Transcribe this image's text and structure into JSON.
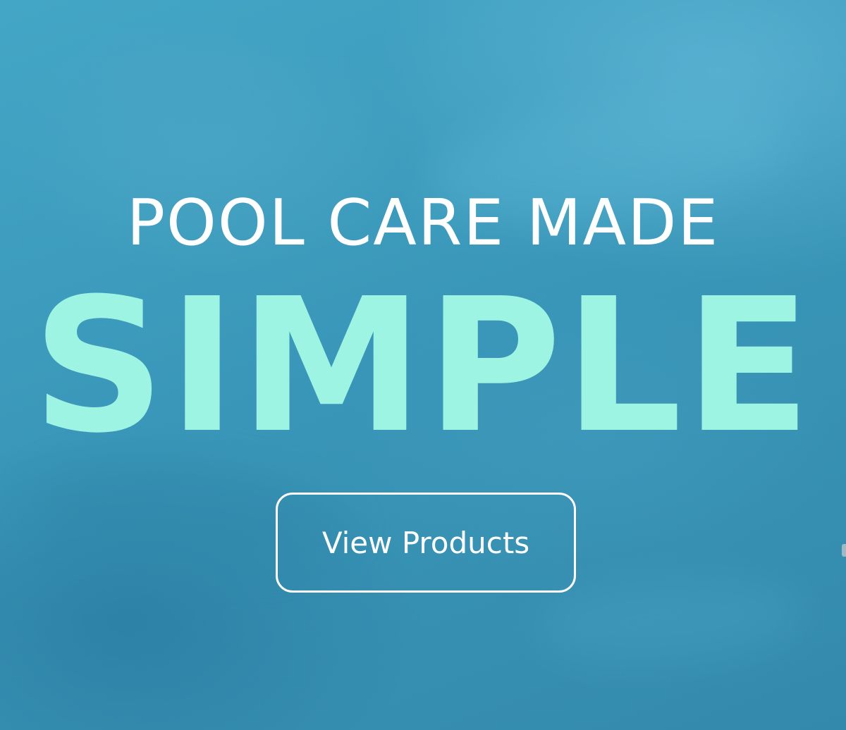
{
  "hero": {
    "line1": "POOL CARE MADE",
    "line2": "SIMPLE",
    "cta_label": "View Products"
  },
  "colors": {
    "background": "#3c9bbd",
    "line1_text": "#ffffff",
    "line2_text": "#9ef4e2",
    "cta_border": "#ffffff",
    "cta_text": "#ffffff"
  }
}
